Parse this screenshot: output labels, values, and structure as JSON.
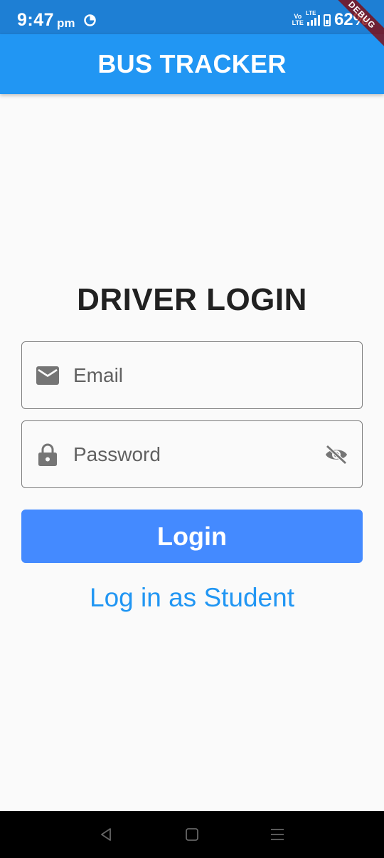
{
  "status_bar": {
    "time": "9:47",
    "ampm": "pm",
    "network_label": "LTE",
    "volte_top": "Vo",
    "volte_bottom": "LTE",
    "battery_percent": "62%"
  },
  "debug_banner": {
    "label": "DEBUG"
  },
  "app_bar": {
    "title": "BUS TRACKER"
  },
  "page": {
    "heading": "DRIVER LOGIN"
  },
  "form": {
    "email": {
      "placeholder": "Email",
      "value": "",
      "icon": "mail-icon"
    },
    "password": {
      "placeholder": "Password",
      "value": "",
      "icon": "lock-icon",
      "toggle_icon": "visibility-off-icon"
    },
    "login_label": "Login",
    "student_link_label": "Log in as Student"
  },
  "nav_bar": {
    "icons": [
      "back-icon",
      "home-icon",
      "menu-icon"
    ]
  },
  "colors": {
    "status_bar": "#1e7fd4",
    "app_bar": "#2196f3",
    "login_button": "#448aff",
    "link": "#2196f3",
    "background": "#fafafa"
  }
}
